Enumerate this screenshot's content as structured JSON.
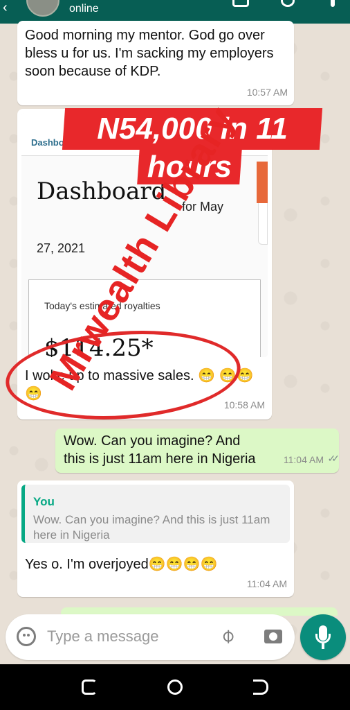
{
  "header": {
    "status": "online"
  },
  "messages": {
    "m1": {
      "text": "Good morning my mentor. God go over bless u for us. I'm sacking my employers soon because of KDP.",
      "time": "10:57 AM"
    },
    "m2": {
      "screenshot": {
        "tab": "Dashbo",
        "title": "Dashboard",
        "subtitle": "for May",
        "date": "27, 2021",
        "card_label": "Today's estimated royalties",
        "card_value": "$114.25*"
      },
      "caption": "I woke up to massive sales. 😁 😁😁😁",
      "time": "10:58 AM"
    },
    "m3": {
      "text": "Wow. Can you imagine? And this is just 11am here in Nigeria",
      "time": "11:04 AM",
      "ticks": "✓✓"
    },
    "m4": {
      "quote_author": "You",
      "quote_text": "Wow. Can you imagine? And this is just 11am here in Nigeria",
      "text": "Yes o. I'm overjoyed😁😁😁😁",
      "time": "11:04 AM"
    }
  },
  "composer": {
    "placeholder": "Type a message"
  },
  "overlay": {
    "banner_line1": "N54,000 in 11",
    "banner_line2": "hours",
    "watermark": "Mrwealth Library"
  },
  "colors": {
    "header": "#075e54",
    "outgoing_bubble": "#dcf8c6",
    "accent": "#0a8d7c",
    "overlay_red": "#e8282b"
  }
}
